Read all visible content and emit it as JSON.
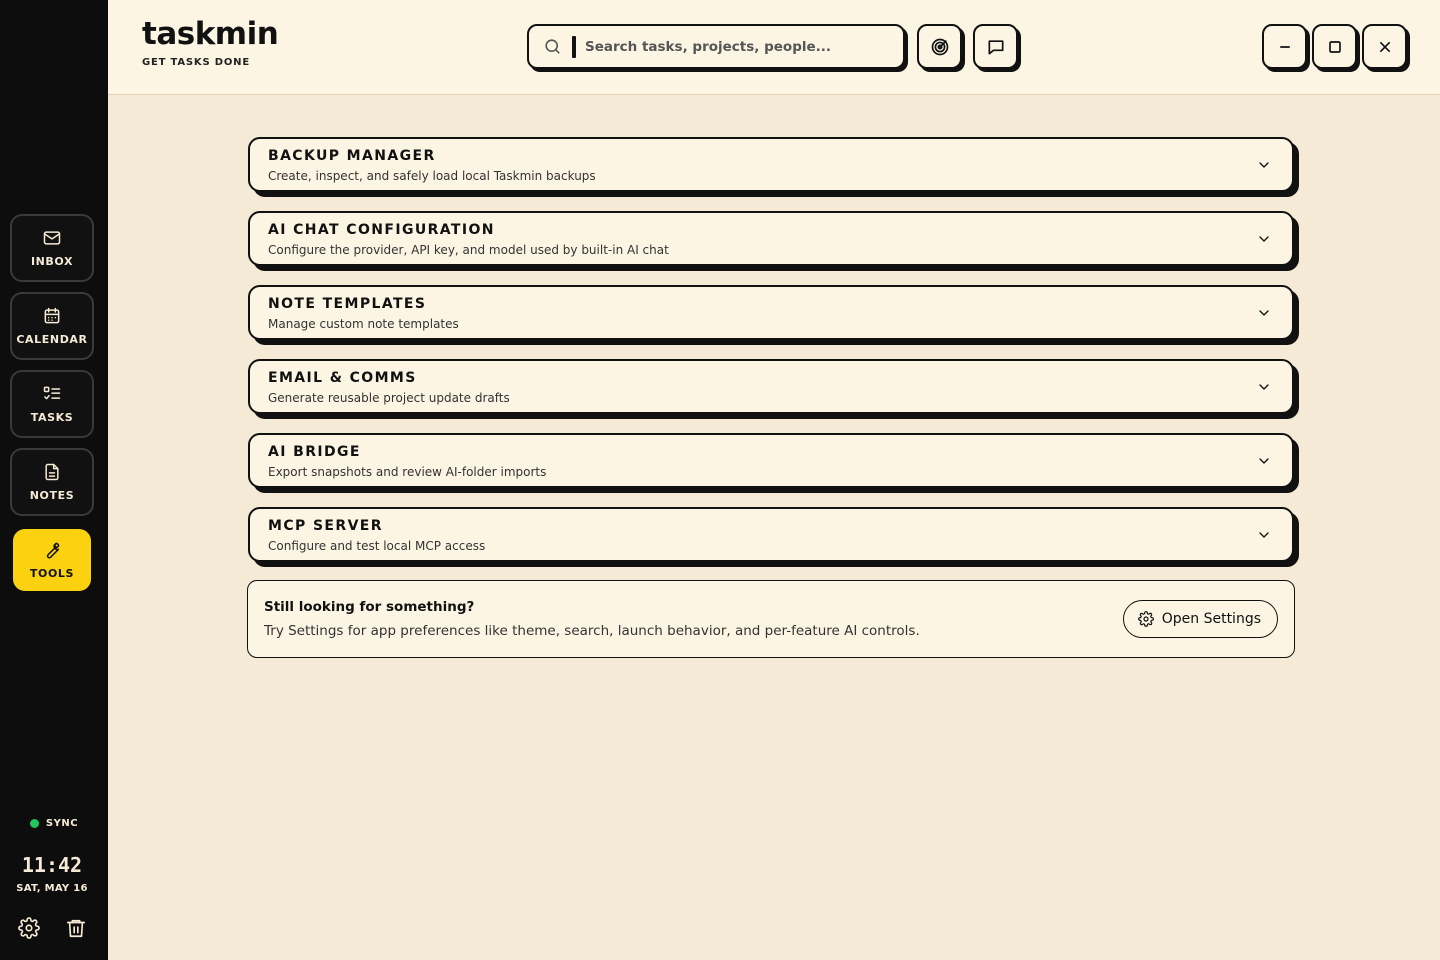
{
  "app": {
    "title": "taskmin",
    "tagline": "GET TASKS DONE"
  },
  "search": {
    "placeholder": "Search tasks, projects, people..."
  },
  "header_buttons": [
    {
      "name": "focus-radar",
      "icon": "radar-icon"
    },
    {
      "name": "ai-chat",
      "icon": "chat-bubble-icon"
    }
  ],
  "window_controls": [
    {
      "name": "minimize",
      "icon": "minimize-icon"
    },
    {
      "name": "maximize",
      "icon": "maximize-icon"
    },
    {
      "name": "close",
      "icon": "close-icon"
    }
  ],
  "sidebar": {
    "items": [
      {
        "label": "INBOX",
        "icon": "mail-icon",
        "active": false
      },
      {
        "label": "CALENDAR",
        "icon": "calendar-icon",
        "active": false
      },
      {
        "label": "TASKS",
        "icon": "task-list-icon",
        "active": false
      },
      {
        "label": "NOTES",
        "icon": "document-icon",
        "active": false
      },
      {
        "label": "TOOLS",
        "icon": "wrench-icon",
        "active": true
      }
    ],
    "sync_label": "SYNC",
    "sync_color": "#22c55e",
    "time": "11:42",
    "date": "SAT, MAY 16",
    "footer_icons": [
      "gear-icon",
      "trash-icon"
    ]
  },
  "tools": [
    {
      "title": "BACKUP MANAGER",
      "description": "Create, inspect, and safely load local Taskmin backups"
    },
    {
      "title": "AI CHAT CONFIGURATION",
      "description": "Configure the provider, API key, and model used by built-in AI chat"
    },
    {
      "title": "NOTE TEMPLATES",
      "description": "Manage custom note templates"
    },
    {
      "title": "EMAIL & COMMS",
      "description": "Generate reusable project update drafts"
    },
    {
      "title": "AI BRIDGE",
      "description": "Export snapshots and review AI-folder imports"
    },
    {
      "title": "MCP SERVER",
      "description": "Configure and test local MCP access"
    }
  ],
  "help": {
    "title": "Still looking for something?",
    "body": "Try Settings for app preferences like theme, search, launch behavior, and per-feature AI controls.",
    "button_label": "Open Settings"
  },
  "colors": {
    "accent": "#fcd10f",
    "sidebar_bg": "#0d0d0d",
    "page_bg": "#f5ead6",
    "card_bg": "#fdf5e4"
  }
}
